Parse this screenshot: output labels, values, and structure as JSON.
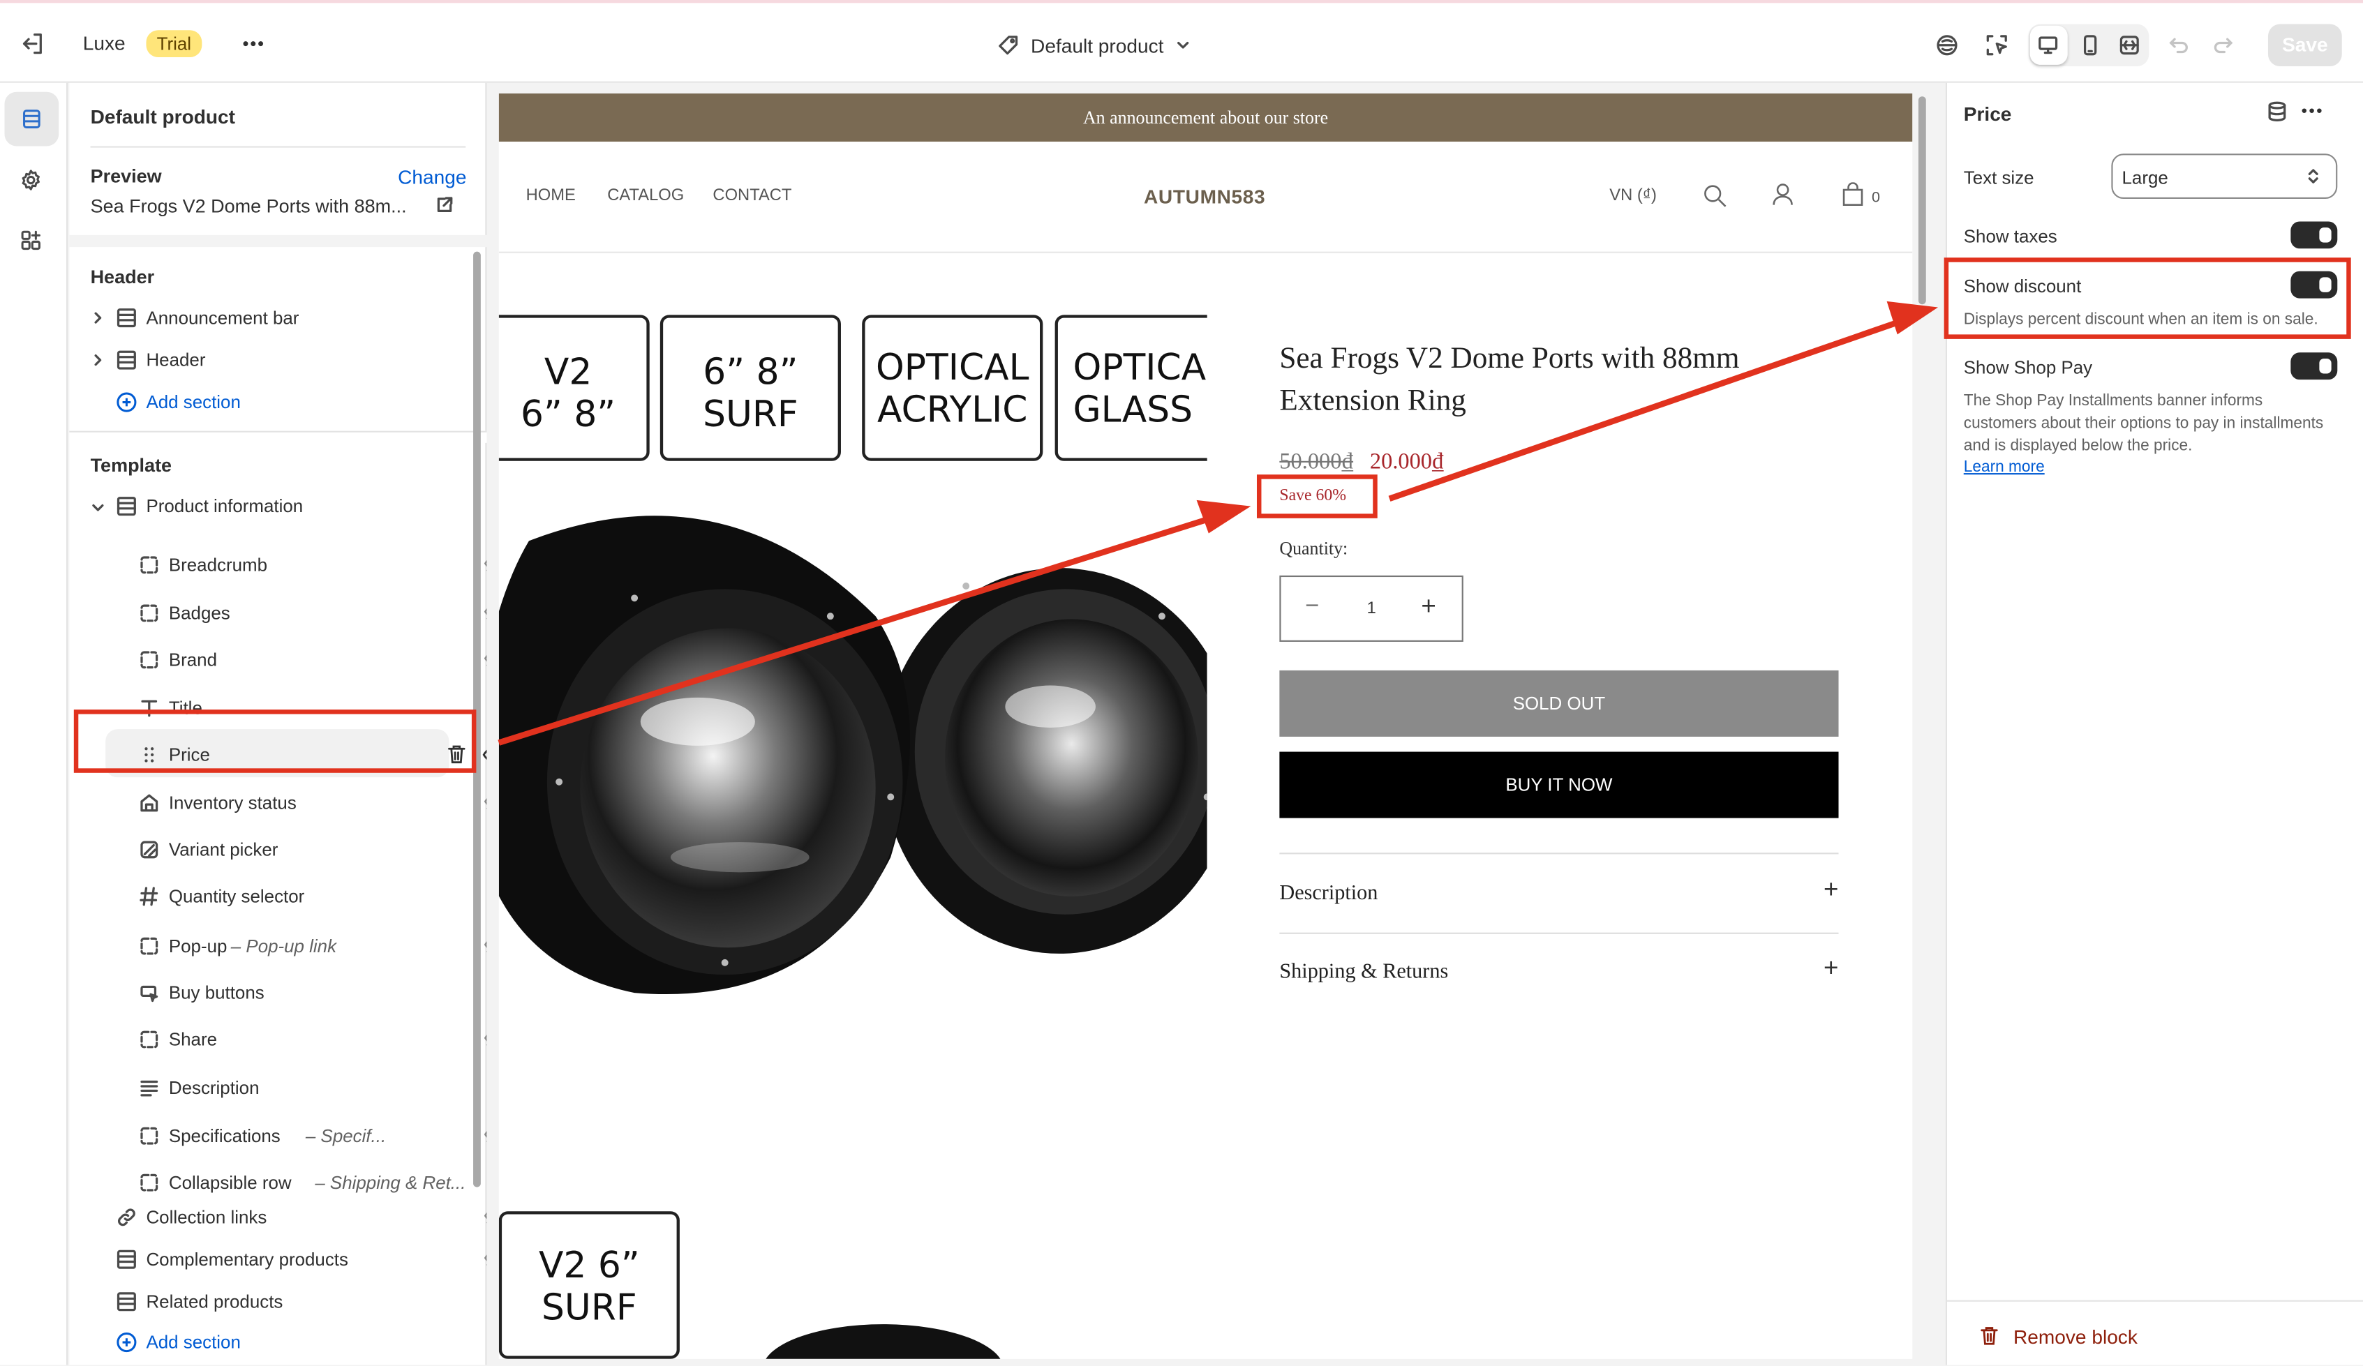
{
  "topbar": {
    "exit_icon": "exit-icon",
    "theme_name": "Luxe",
    "trial_badge": "Trial",
    "more_icon": "more-horizontal-icon",
    "template_selector": "Default product",
    "save_label": "Save",
    "icons": [
      "inspector-icon",
      "select-element-icon",
      "desktop-view-icon",
      "mobile-view-icon",
      "full-width-icon",
      "undo-icon",
      "redo-icon"
    ]
  },
  "rail": {
    "items": [
      "sections-icon",
      "settings-gear-icon",
      "apps-icon"
    ]
  },
  "left": {
    "title": "Default product",
    "preview_label": "Preview",
    "change_link": "Change",
    "preview_product": "Sea Frogs V2 Dome Ports with 88m...",
    "header_group": "Header",
    "header_items": [
      "Announcement bar",
      "Header"
    ],
    "add_section": "Add section",
    "template_group": "Template",
    "product_information": "Product information",
    "blocks": [
      {
        "label": "Breadcrumb",
        "icon": "block-icon",
        "hidden": true
      },
      {
        "label": "Badges",
        "icon": "block-icon",
        "hidden": true
      },
      {
        "label": "Brand",
        "icon": "block-icon",
        "hidden": true
      },
      {
        "label": "Title",
        "icon": "text-icon",
        "hidden": false
      },
      {
        "label": "Price",
        "icon": "drag-handle-icon",
        "hidden": false,
        "selected": true
      },
      {
        "label": "Inventory status",
        "icon": "inventory-icon",
        "hidden": true
      },
      {
        "label": "Variant picker",
        "icon": "variant-icon",
        "hidden": false
      },
      {
        "label": "Quantity selector",
        "icon": "hash-icon",
        "hidden": false
      },
      {
        "label": "Pop-up",
        "sub": "Pop-up link",
        "icon": "block-icon",
        "hidden": true
      },
      {
        "label": "Buy buttons",
        "icon": "cursor-icon",
        "hidden": false
      },
      {
        "label": "Share",
        "icon": "block-icon",
        "hidden": true
      },
      {
        "label": "Description",
        "icon": "lines-icon",
        "hidden": false
      },
      {
        "label": "Specifications",
        "sub": "Specif...",
        "icon": "block-icon",
        "hidden": true
      },
      {
        "label": "Collapsible row",
        "sub": "Shipping & Ret...",
        "icon": "block-icon",
        "hidden": false
      }
    ],
    "sections": [
      {
        "label": "Collection links",
        "icon": "link-icon",
        "hidden": true
      },
      {
        "label": "Complementary products",
        "icon": "section-icon",
        "hidden": true
      },
      {
        "label": "Related products",
        "icon": "section-icon",
        "hidden": false
      }
    ],
    "add_section2": "Add section"
  },
  "store": {
    "announcement": "An announcement about our store",
    "nav": [
      "HOME",
      "CATALOG",
      "CONTACT"
    ],
    "logo": "AUTUMN583",
    "currency": "VN (₫)",
    "cart_count": "0",
    "cards": [
      [
        "V2",
        "6” 8”"
      ],
      [
        "6” 8”",
        "SURF"
      ],
      [
        "OPTICAL",
        "ACRYLIC"
      ],
      [
        "OPTICA",
        "GLASS"
      ]
    ],
    "bottom_card": [
      "V2 6”",
      "SURF"
    ],
    "product_title": "Sea Frogs V2 Dome Ports with 88mm Extension Ring",
    "compare_price": "50.000₫",
    "price": "20.000₫",
    "save_badge": "Save 60%",
    "quantity_label": "Quantity:",
    "quantity_value": "1",
    "sold_out": "SOLD OUT",
    "buy_now": "BUY IT NOW",
    "accordions": [
      "Description",
      "Shipping & Returns"
    ]
  },
  "right": {
    "title": "Price",
    "text_size_label": "Text size",
    "text_size_value": "Large",
    "show_taxes": "Show taxes",
    "show_discount": "Show discount",
    "discount_help": "Displays percent discount when an item is on sale.",
    "show_shop_pay": "Show Shop Pay",
    "shop_pay_help": "The Shop Pay Installments banner informs customers about their options to pay in installments and is displayed below the price.",
    "learn_more": "Learn more",
    "remove_block": "Remove block",
    "toggles": {
      "show_taxes": true,
      "show_discount": true,
      "show_shop_pay": true
    }
  },
  "colors": {
    "annotation": "#e1321e",
    "announcement_bg": "#7a6a53",
    "sale_red": "#a8262b",
    "trial_badge": "#ffe57a",
    "remove_red": "#8e1f0b",
    "link_blue": "#005bd3"
  }
}
